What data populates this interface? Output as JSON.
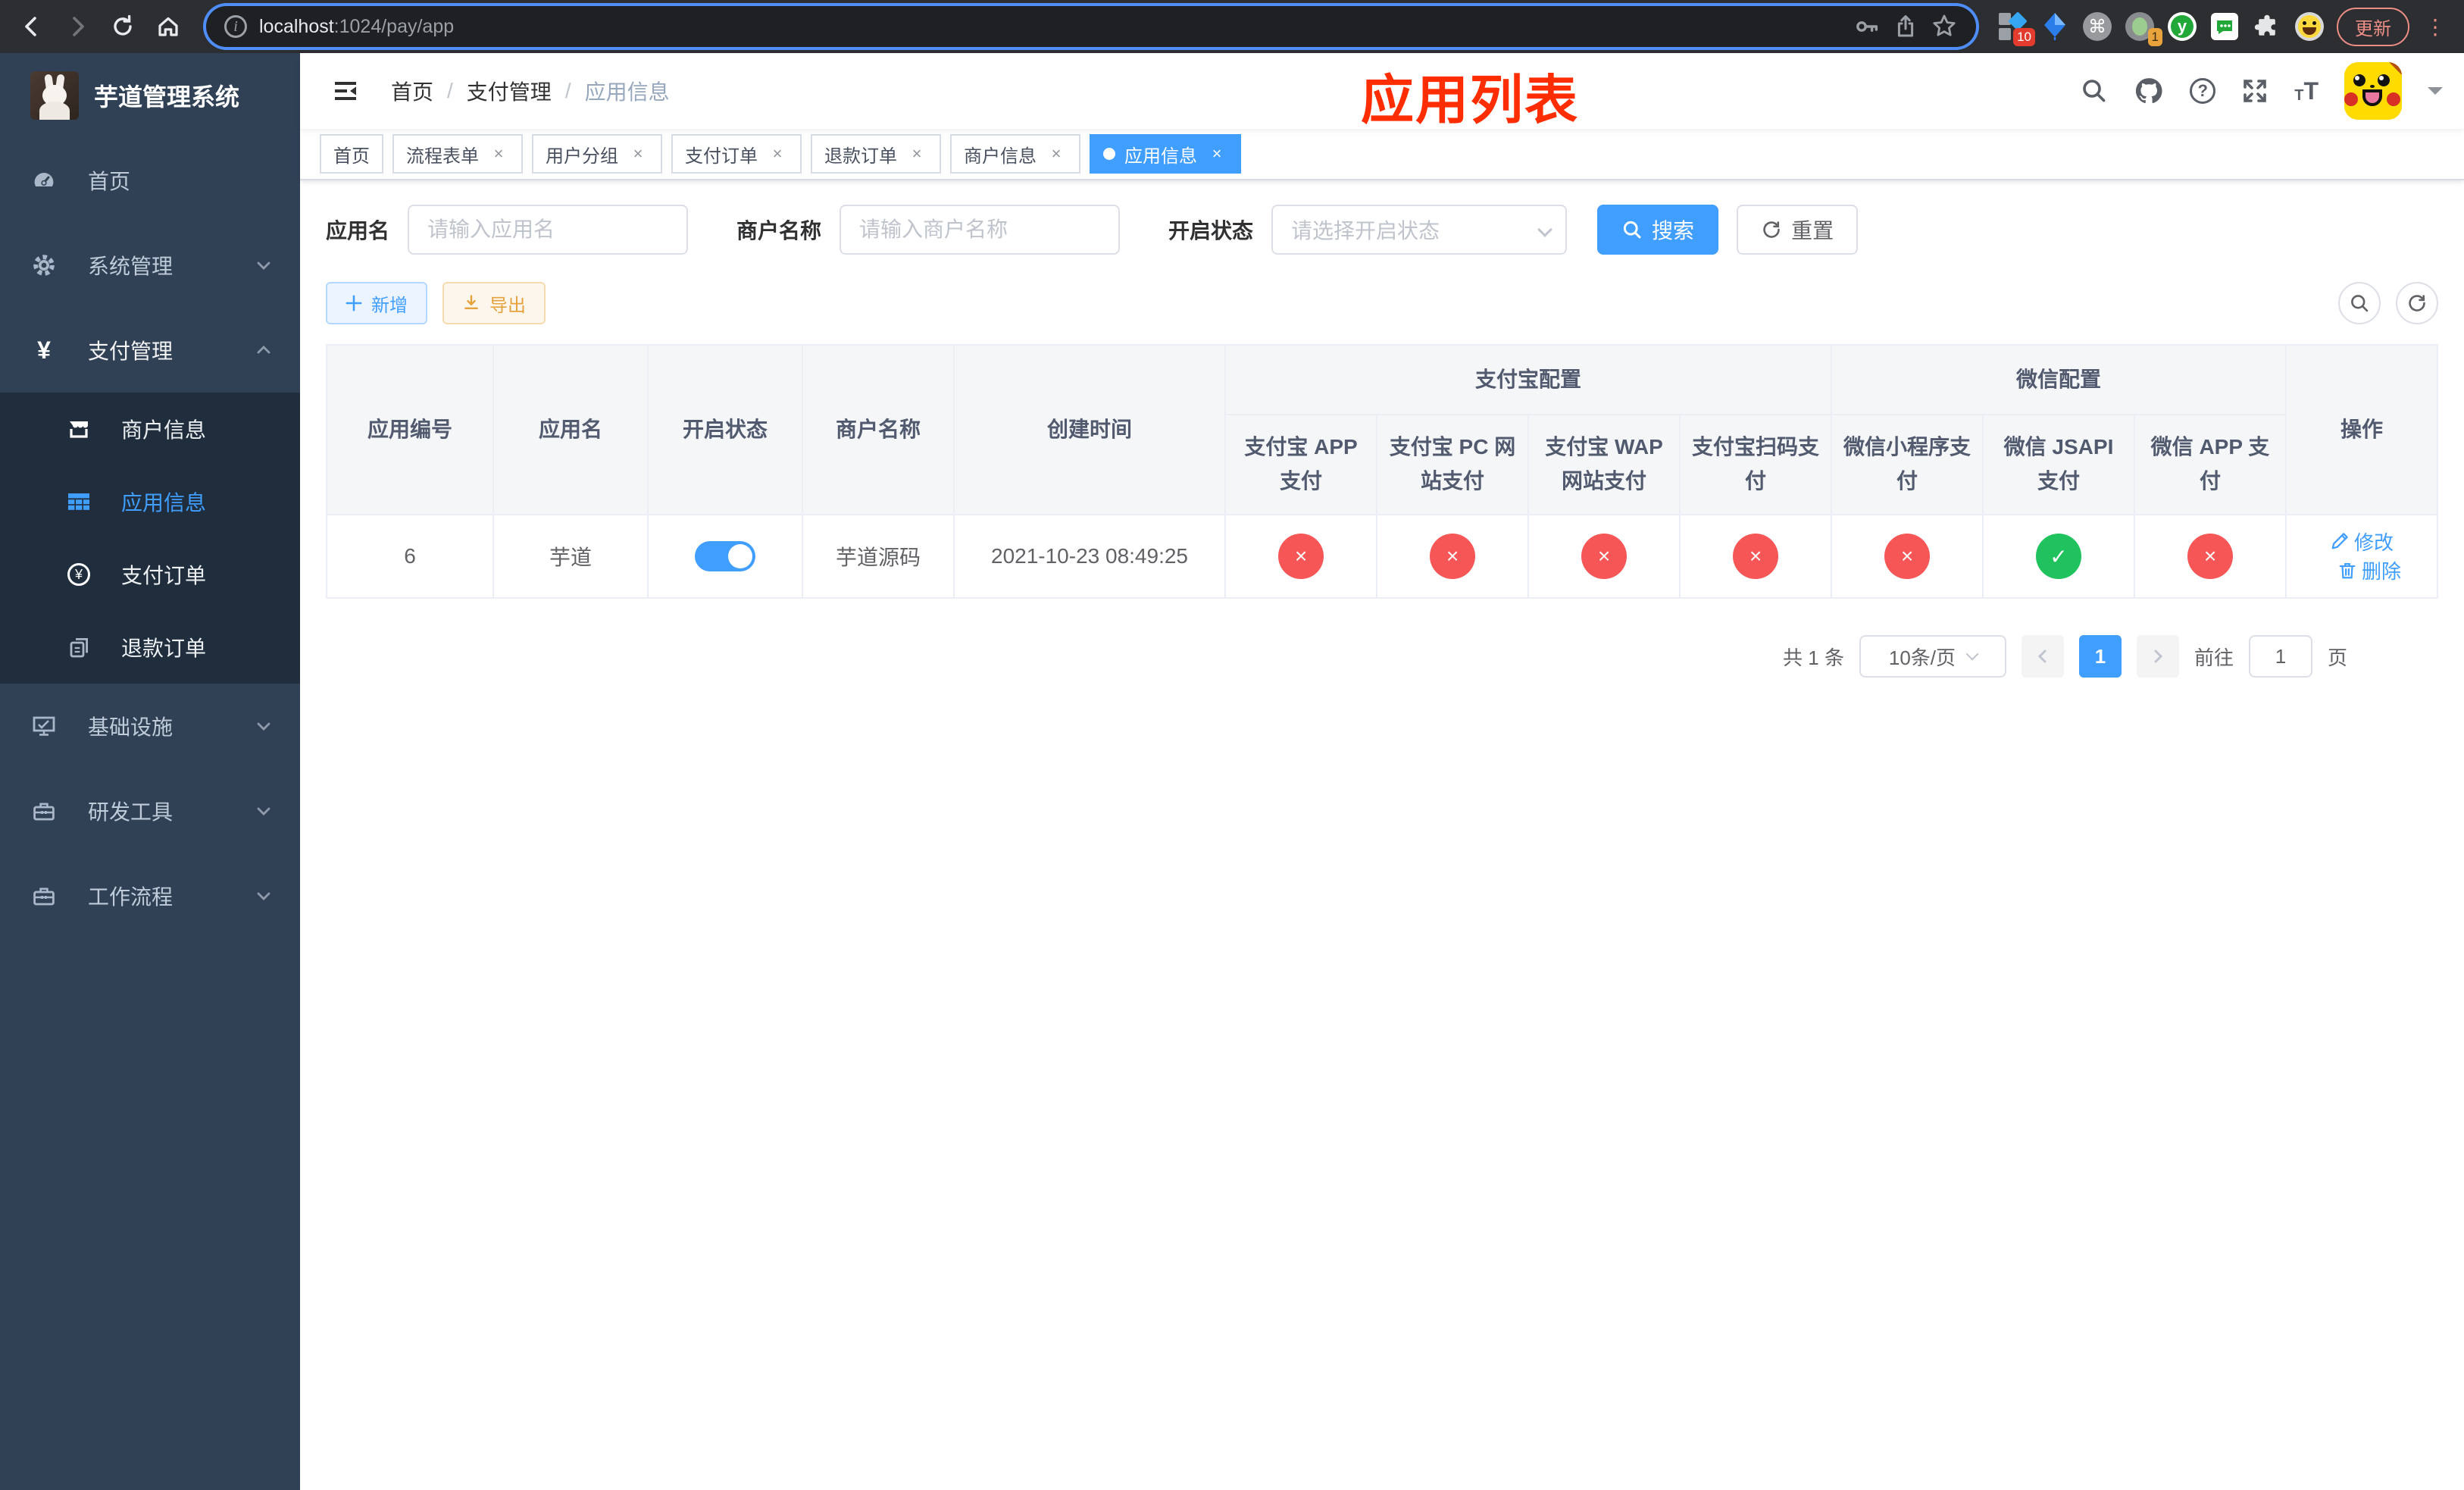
{
  "colors": {
    "accent": "#409eff",
    "status_on": "#1fc25c",
    "status_off": "#f65656",
    "annotation_red": "#ff2d00"
  },
  "browser": {
    "url_host": "localhost",
    "url_rest": ":1024/pay/app",
    "extension_badge_blocks": "10",
    "extension_badge_profile": "1",
    "update_label": "更新"
  },
  "sidebar": {
    "title": "芋道管理系统",
    "items": {
      "home": {
        "label": "首页"
      },
      "system": {
        "label": "系统管理"
      },
      "payment": {
        "label": "支付管理"
      },
      "infra": {
        "label": "基础设施"
      },
      "devtools": {
        "label": "研发工具"
      },
      "workflow": {
        "label": "工作流程"
      }
    },
    "payment_children": {
      "merchant": {
        "label": "商户信息"
      },
      "app": {
        "label": "应用信息",
        "active": true
      },
      "order": {
        "label": "支付订单"
      },
      "refund": {
        "label": "退款订单"
      }
    }
  },
  "header": {
    "breadcrumb": [
      "首页",
      "支付管理",
      "应用信息"
    ],
    "annotation": "应用列表"
  },
  "tabs": [
    {
      "label": "首页",
      "closable": false,
      "active": false
    },
    {
      "label": "流程表单",
      "closable": true,
      "active": false
    },
    {
      "label": "用户分组",
      "closable": true,
      "active": false
    },
    {
      "label": "支付订单",
      "closable": true,
      "active": false
    },
    {
      "label": "退款订单",
      "closable": true,
      "active": false
    },
    {
      "label": "商户信息",
      "closable": true,
      "active": false
    },
    {
      "label": "应用信息",
      "closable": true,
      "active": true
    }
  ],
  "filters": {
    "app_name_label": "应用名",
    "app_name_placeholder": "请输入应用名",
    "merchant_label": "商户名称",
    "merchant_placeholder": "请输入商户名称",
    "status_label": "开启状态",
    "status_placeholder": "请选择开启状态",
    "search_label": "搜索",
    "reset_label": "重置"
  },
  "toolbar": {
    "add_label": "新增",
    "export_label": "导出"
  },
  "table": {
    "columns": {
      "id": "应用编号",
      "name": "应用名",
      "status": "开启状态",
      "merchant": "商户名称",
      "created": "创建时间",
      "alipay_group": "支付宝配置",
      "wechat_group": "微信配置",
      "alipay_app": "支付宝 APP 支付",
      "alipay_pc": "支付宝 PC 网站支付",
      "alipay_wap": "支付宝 WAP 网站支付",
      "alipay_scan": "支付宝扫码支付",
      "wx_mini": "微信小程序支付",
      "wx_jsapi": "微信 JSAPI 支付",
      "wx_app": "微信 APP 支付",
      "actions": "操作"
    },
    "row": {
      "id": "6",
      "name": "芋道",
      "enabled": true,
      "merchant": "芋道源码",
      "created": "2021-10-23 08:49:25",
      "statuses": [
        false,
        false,
        false,
        false,
        false,
        true,
        false
      ],
      "edit_label": "修改",
      "delete_label": "删除"
    }
  },
  "pagination": {
    "total": "共 1 条",
    "page_size": "10条/页",
    "page": "1",
    "goto_prefix": "前往",
    "goto_value": "1",
    "goto_suffix": "页"
  }
}
